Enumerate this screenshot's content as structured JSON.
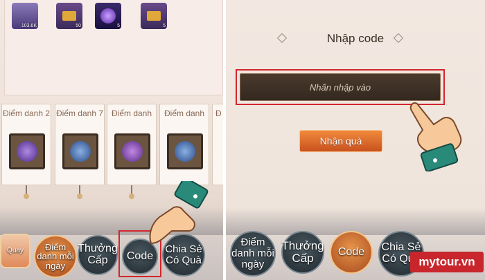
{
  "left_panel": {
    "inventory": [
      {
        "qty": "103.6K",
        "icon": "silver-ingot-icon",
        "color": "#7a6aa8"
      },
      {
        "qty": "50",
        "icon": "gold-chest-icon",
        "color": "#c07a2a"
      },
      {
        "qty": "5",
        "icon": "purple-orb-icon",
        "color": "#4a2a8a"
      },
      {
        "qty": "5",
        "icon": "gold-chest-icon",
        "color": "#c07a2a"
      }
    ],
    "banners": [
      {
        "title": "Điểm danh 2",
        "orb_color": "#5a3a9a"
      },
      {
        "title": "Điểm danh 7",
        "orb_color": "#3a5a9a"
      },
      {
        "title": "Điểm danh",
        "orb_color": "#6a3a9a"
      },
      {
        "title": "Điểm danh",
        "orb_color": "#3a5a9a"
      },
      {
        "title": "Đ",
        "orb_color": "#3a5a9a"
      }
    ],
    "bottom_menu": {
      "spin": "Quay",
      "daily": "Điểm danh mỗi ngày",
      "level_reward": "Thưởng Cấp",
      "code": "Code",
      "share": "Chia Sẻ Có Quà"
    }
  },
  "right_panel": {
    "title": "Nhập code",
    "input_placeholder": "Nhấn nhập vào",
    "receive_button": "Nhận quà",
    "bottom_menu": {
      "daily": "Điểm danh mỗi ngày",
      "level_reward": "Thưởng Cấp",
      "code": "Code",
      "share": "Chia Sẻ Có Quà"
    }
  },
  "watermark": "mytour.vn",
  "colors": {
    "highlight": "#d2262c",
    "accent": "#e8944a",
    "hand_cuff": "#2a8a7a"
  }
}
